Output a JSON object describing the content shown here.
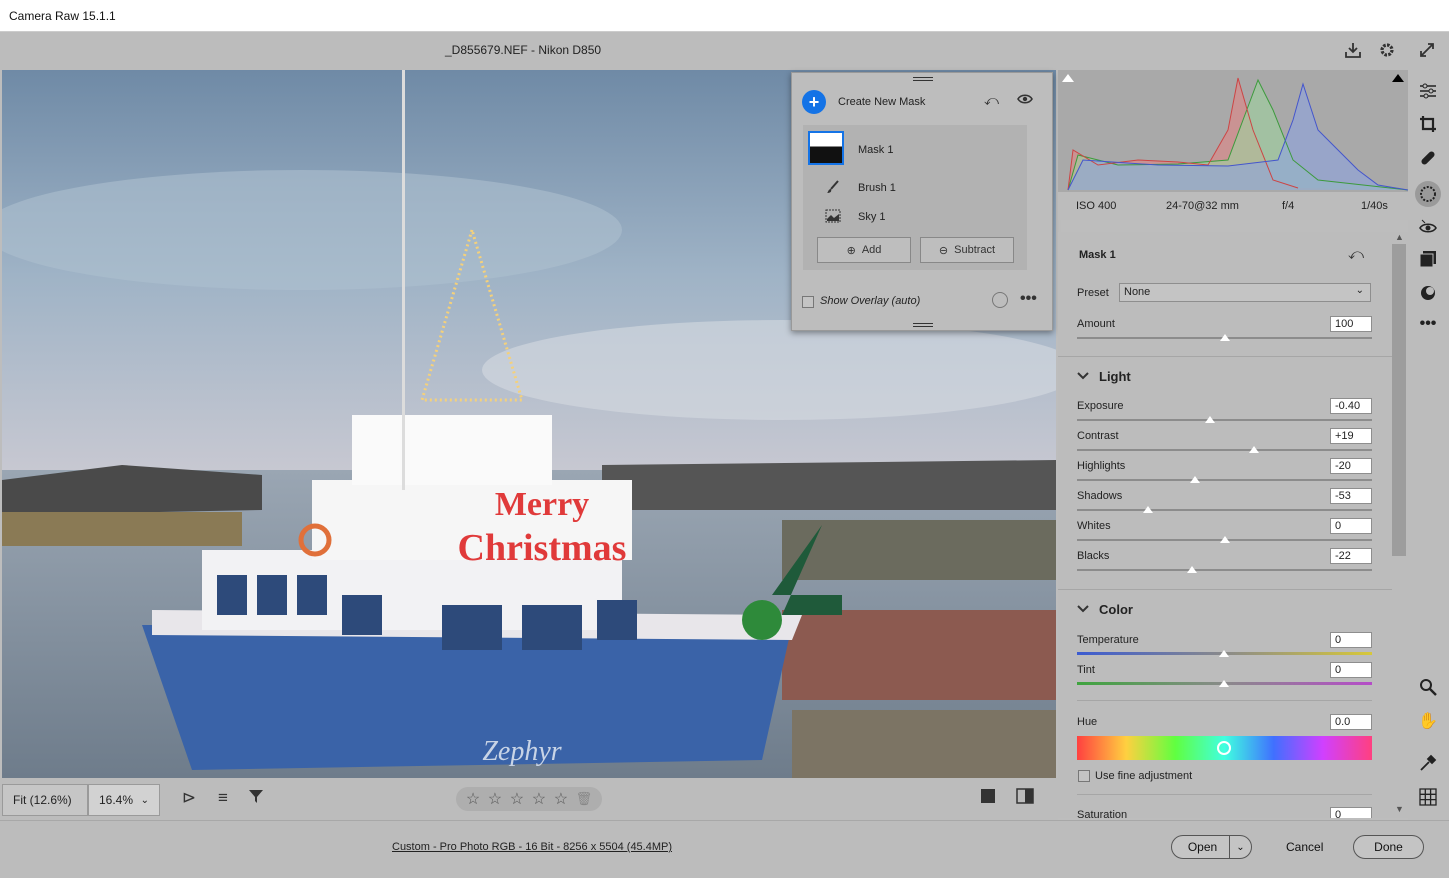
{
  "window": {
    "title": "Camera Raw 15.1.1"
  },
  "header": {
    "filename": "_D855679.NEF  -  Nikon D850",
    "save_icon": "download-icon",
    "settings_icon": "gear-icon",
    "fullscreen_icon": "expand-icon"
  },
  "bottom": {
    "zoom_fit": "Fit (12.6%)",
    "zoom_current": "16.4%",
    "rating_stars": 0
  },
  "footer": {
    "workflow_link": "Custom - Pro Photo RGB - 16 Bit - 8256 x 5504 (45.4MP)",
    "open_label": "Open",
    "cancel_label": "Cancel",
    "done_label": "Done"
  },
  "mask_panel": {
    "create_label": "Create New Mask",
    "mask_name": "Mask 1",
    "components": [
      {
        "label": "Brush 1",
        "icon": "brush-icon"
      },
      {
        "label": "Sky 1",
        "icon": "sky-icon"
      }
    ],
    "add_label": "Add",
    "subtract_label": "Subtract",
    "overlay_label": "Show Overlay (auto)",
    "overlay_checked": false
  },
  "camera_info": {
    "iso": "ISO 400",
    "lens": "24-70@32 mm",
    "aperture": "f/4",
    "shutter": "1/40s"
  },
  "panel": {
    "title": "Mask 1",
    "preset_label": "Preset",
    "preset_value": "None",
    "amount_label": "Amount",
    "amount_value": "100",
    "amount_level": 0.5,
    "light_title": "Light",
    "light_sliders": [
      {
        "label": "Exposure",
        "value": "-0.40",
        "level": 0.45
      },
      {
        "label": "Contrast",
        "value": "+19",
        "level": 0.6
      },
      {
        "label": "Highlights",
        "value": "-20",
        "level": 0.4
      },
      {
        "label": "Shadows",
        "value": "-53",
        "level": 0.24
      },
      {
        "label": "Whites",
        "value": "0",
        "level": 0.5
      },
      {
        "label": "Blacks",
        "value": "-22",
        "level": 0.39
      }
    ],
    "color_title": "Color",
    "temperature_label": "Temperature",
    "temperature_value": "0",
    "tint_label": "Tint",
    "tint_value": "0",
    "hue_label": "Hue",
    "hue_value": "0.0",
    "fine_adjust_label": "Use fine adjustment",
    "saturation_label": "Saturation",
    "saturation_value": "0"
  },
  "colors": {
    "accent": "#1473e6",
    "panel_bg": "#bcbcbc"
  }
}
